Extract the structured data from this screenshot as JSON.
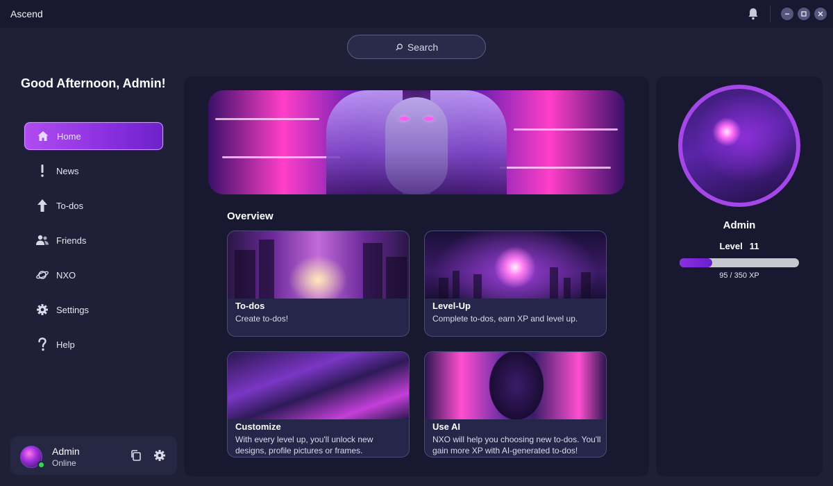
{
  "app": {
    "title": "Ascend"
  },
  "search": {
    "label": "Search"
  },
  "sidebar": {
    "greeting": "Good Afternoon, Admin!",
    "items": [
      {
        "label": "Home",
        "icon": "home-icon",
        "active": true
      },
      {
        "label": "News",
        "icon": "exclamation-icon"
      },
      {
        "label": "To-dos",
        "icon": "arrow-up-icon"
      },
      {
        "label": "Friends",
        "icon": "friends-icon"
      },
      {
        "label": "NXO",
        "icon": "planet-icon"
      },
      {
        "label": "Settings",
        "icon": "gear-icon"
      },
      {
        "label": "Help",
        "icon": "question-icon"
      }
    ]
  },
  "user_card": {
    "name": "Admin",
    "status": "Online",
    "status_color": "#3ad15a"
  },
  "overview": {
    "title": "Overview",
    "cards": [
      {
        "title": "To-dos",
        "description": "Create to-dos!"
      },
      {
        "title": "Level-Up",
        "description": "Complete to-dos, earn XP and level up."
      },
      {
        "title": "Customize",
        "description": "With every level up, you'll unlock new designs, profile pictures or frames."
      },
      {
        "title": "Use AI",
        "description": "NXO will help you choosing new to-dos. You'll gain more XP with AI-generated to-dos!"
      }
    ]
  },
  "profile": {
    "name": "Admin",
    "level_label": "Level",
    "level_value": "11",
    "xp_current": 95,
    "xp_max": 350,
    "xp_text": "95 / 350 XP"
  },
  "colors": {
    "accent": "#9a3ce6",
    "background": "#1f2038",
    "panel": "#181930"
  }
}
